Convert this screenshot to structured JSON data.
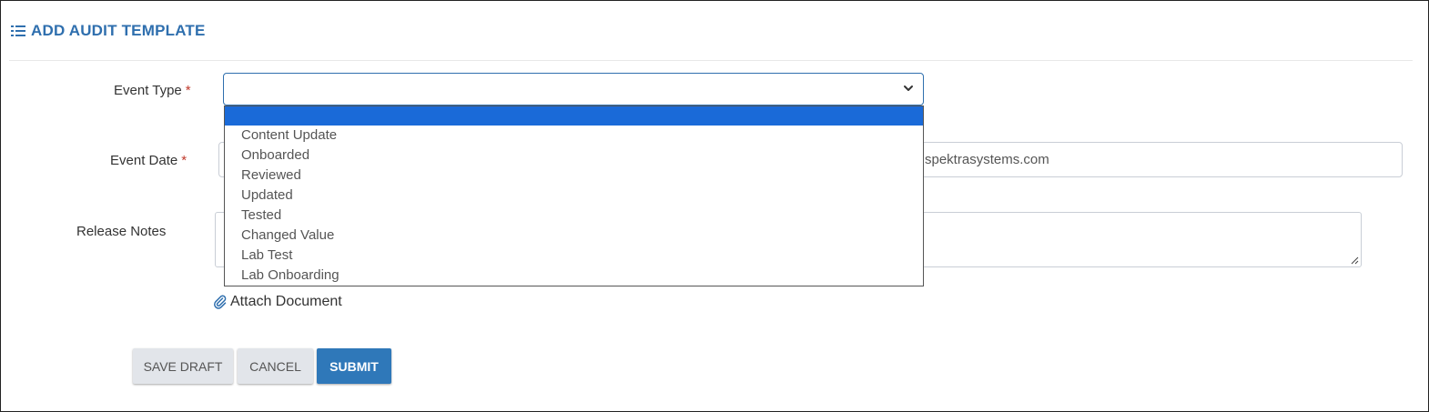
{
  "header": {
    "title": "ADD AUDIT TEMPLATE",
    "icon": "list-icon"
  },
  "form": {
    "event_type": {
      "label": "Event Type",
      "required_marker": "*",
      "value": "",
      "options": [
        "",
        "Content Update",
        "Onboarded",
        "Reviewed",
        "Updated",
        "Tested",
        "Changed Value",
        "Lab Test",
        "Lab Onboarding"
      ],
      "highlighted_option_index": 0
    },
    "event_date": {
      "label": "Event Date",
      "required_marker": "*",
      "visible_text": "spektrasystems.com"
    },
    "release_notes": {
      "label": "Release Notes",
      "value": ""
    },
    "attach": {
      "label": "Attach Document",
      "icon": "paperclip-icon"
    }
  },
  "buttons": {
    "save_draft": "SAVE DRAFT",
    "cancel": "CANCEL",
    "submit": "SUBMIT"
  },
  "colors": {
    "accent": "#2f6fae",
    "highlight": "#1a6ad8",
    "required": "#c0392b",
    "primary_button": "#2f78b9"
  }
}
